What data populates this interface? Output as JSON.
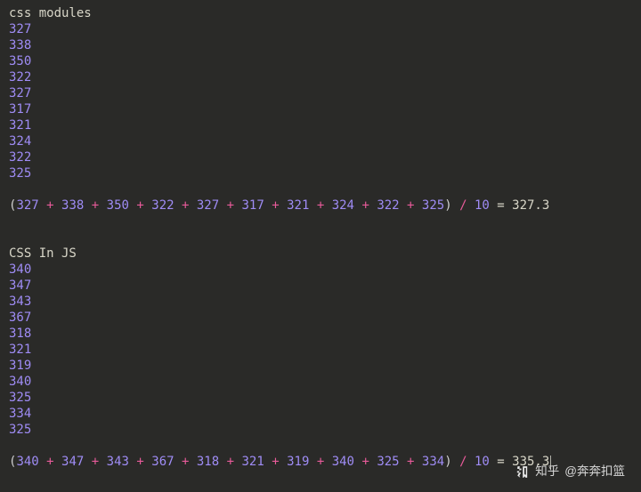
{
  "blocks": [
    {
      "title": "css modules",
      "values": [
        327,
        338,
        350,
        322,
        327,
        317,
        321,
        324,
        322,
        325
      ],
      "divisor": 10,
      "result": "327.3",
      "showCursor": false
    },
    {
      "title": "CSS In JS",
      "values": [
        340,
        347,
        343,
        367,
        318,
        321,
        319,
        340,
        325,
        334,
        325
      ],
      "sumValues": [
        340,
        347,
        343,
        367,
        318,
        321,
        319,
        340,
        325,
        334
      ],
      "divisor": 10,
      "result": "335.3",
      "showCursor": true
    }
  ],
  "watermark": {
    "prefix": "知乎",
    "user": "@奔奔扣篮"
  }
}
